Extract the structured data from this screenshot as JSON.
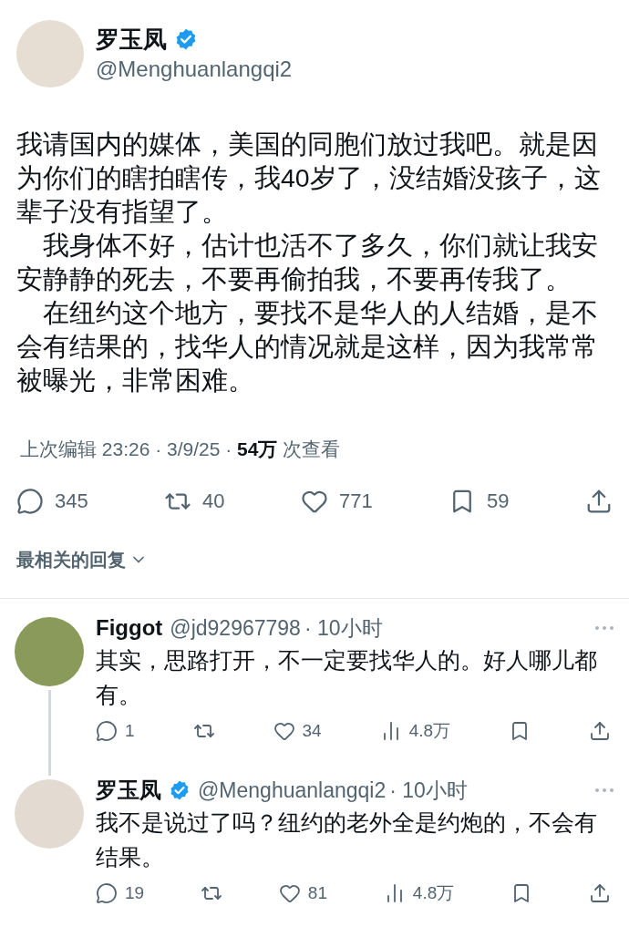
{
  "post": {
    "author": {
      "name": "罗玉凤",
      "verified": true,
      "handle": "@Menghuanlangqi2"
    },
    "paragraphs": [
      "我请国内的媒体，美国的同胞们放过我吧。就是因为你们的瞎拍瞎传，我40岁了，没结婚没孩子，这辈子没有指望了。",
      "我身体不好，估计也活不了多久，你们就让我安安静静的死去，不要再偷拍我，不要再传我了。",
      "在纽约这个地方，要找不是华人的人结婚，是不会有结果的，找华人的情况就是这样，因为我常常被曝光，非常困难。"
    ],
    "meta": "上次编辑 23:26 · 3/9/25 · **54万** 次查看",
    "actions": [
      {
        "kind": "reply",
        "count": "345"
      },
      {
        "kind": "repost",
        "count": "40"
      },
      {
        "kind": "like",
        "count": "771"
      },
      {
        "kind": "bookmark",
        "count": "59"
      },
      {
        "kind": "share"
      }
    ]
  },
  "sort_menu": {
    "label": "最相关的回复"
  },
  "replies": [
    {
      "author": {
        "name": "Figgot",
        "verified": false,
        "handle": "@jd92967798",
        "time": "· 10小时"
      },
      "text": "其实，思路打开，不一定要找华人的。好人哪儿都有。",
      "actions": [
        {
          "kind": "reply",
          "count": "1"
        },
        {
          "kind": "repost"
        },
        {
          "kind": "like",
          "count": "34"
        },
        {
          "kind": "views",
          "count": "4.8万"
        },
        {
          "kind": "bookmark"
        },
        {
          "kind": "share"
        }
      ]
    },
    {
      "author": {
        "name": "罗玉凤",
        "verified": true,
        "handle": "@Menghuanlangqi2",
        "time": "· 10小时"
      },
      "text": "我不是说过了吗？纽约的老外全是约炮的，不会有结果。",
      "actions": [
        {
          "kind": "reply",
          "count": "19"
        },
        {
          "kind": "repost"
        },
        {
          "kind": "like",
          "count": "81"
        },
        {
          "kind": "views",
          "count": "4.8万"
        },
        {
          "kind": "bookmark"
        },
        {
          "kind": "share"
        }
      ]
    }
  ]
}
